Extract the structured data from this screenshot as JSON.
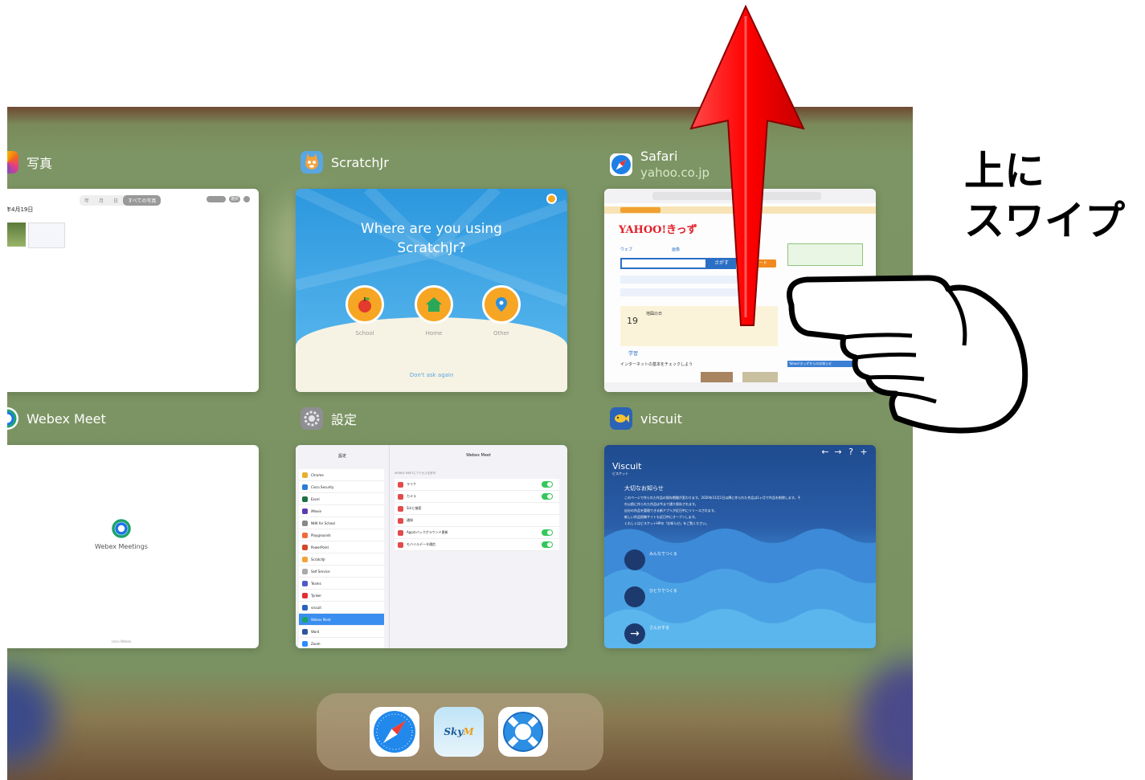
{
  "annotation": {
    "line1": "上に",
    "line2": "スワイプ"
  },
  "cards": {
    "photos": {
      "title": "写真",
      "date": "年4月19日",
      "segments": [
        "年",
        "月",
        "日",
        "すべての写真"
      ],
      "select_label": "選択"
    },
    "scratchjr": {
      "title": "ScratchJr",
      "question": "Where are you using ScratchJr?",
      "options": [
        "School",
        "Home",
        "Other"
      ],
      "dont_ask": "Don't ask again"
    },
    "safari": {
      "title": "Safari",
      "subtitle": "yahoo.co.jp",
      "logo": "YAHOO!きっず",
      "search_btn": "さがす",
      "kb_btn": "キーボード",
      "date_num": "19",
      "date_label": "地図の日",
      "section": "学習",
      "section_text": "インターネットの基本をチェックしよう",
      "tab1": "ウェブ",
      "tab2": "画像",
      "side_text": "Yahoo!きっずからのお知らせ"
    },
    "webex": {
      "title": "Webex Meet",
      "label": "Webex Meetings",
      "footer": "cisco Webex"
    },
    "settings": {
      "title": "設定",
      "left_header": "設定",
      "right_header": "Webex Meet",
      "items": [
        "Chrome",
        "Cisco Security",
        "Excel",
        "iMovie",
        "NHK for School",
        "Playgrounds",
        "PowerPoint",
        "ScratchJr",
        "Self Service",
        "Teams",
        "Tynker",
        "viscuit",
        "Webex Meet",
        "Word",
        "Zoom"
      ],
      "selected_index": 12,
      "access_header": "WEBEX MEETにアクセスを許可",
      "perms": [
        {
          "label": "マイク",
          "on": true
        },
        {
          "label": "カメラ",
          "on": true
        },
        {
          "label": "Siriと検索",
          "on": null
        },
        {
          "label": "通知",
          "on": null
        },
        {
          "label": "Appのバックグラウンド更新",
          "on": true
        },
        {
          "label": "モバイルデータ通信",
          "on": true
        }
      ]
    },
    "viscuit": {
      "title": "viscuit",
      "logo": "Viscuit",
      "logo_sub": "ビスケット",
      "notice_title": "大切なお知らせ",
      "notice_lines": [
        "このページで作られた作品の保存期間が変わります。2020年11月1日以降に作られた作品は1ヶ月で作品を削除します。そ",
        "れ以前に作られた作品は今まで通り保存されます。",
        "自分の作品を管理できる新アプリが近日中にリリースされます。",
        "新しい作品投稿サイトも近日中にオープンします。",
        "くわしくはビスケットHPの「お知らせ」をご覧ください。"
      ],
      "btn1": "みんなでつくる",
      "btn2": "ひとりでつくる",
      "btn3": "さんかする"
    }
  },
  "dock": [
    "Safari",
    "SkyMenu",
    "Self Service"
  ]
}
